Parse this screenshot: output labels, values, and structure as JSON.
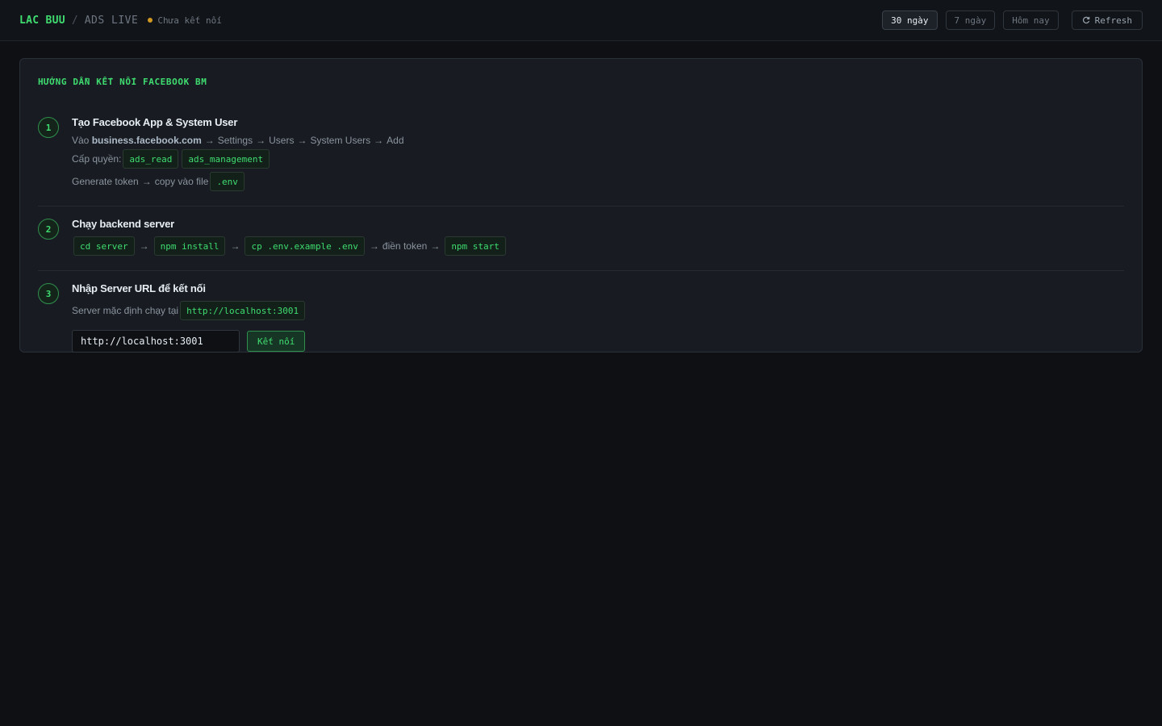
{
  "header": {
    "brand": "LAC BUU",
    "separator": "/",
    "subtitle": "ADS LIVE",
    "status": "Chưa kết nối",
    "status_color": "#d29922",
    "range_buttons": [
      {
        "label": "30 ngày",
        "active": true
      },
      {
        "label": "7 ngày",
        "active": false
      },
      {
        "label": "Hôm nay",
        "active": false
      }
    ],
    "refresh_label": "Refresh",
    "refresh_icon": "refresh-icon"
  },
  "guide": {
    "title": "HƯỚNG DẪN KẾT NỐI FACEBOOK BM",
    "accent": "#3fdc70",
    "steps": [
      {
        "number": "1",
        "title": "Tạo Facebook App & System User",
        "line1": {
          "prefix": "Vào",
          "site": "business.facebook.com",
          "path": [
            "Settings",
            "Users",
            "System Users",
            "Add"
          ]
        },
        "line2": {
          "label": "Cấp quyền:",
          "codes": [
            "ads_read",
            "ads_management"
          ]
        },
        "line3": {
          "label": "Generate token",
          "middle": "copy vào file",
          "code": ".env"
        }
      },
      {
        "number": "2",
        "title": "Chạy backend server",
        "commands": [
          "cd server",
          "npm install",
          "cp .env.example .env"
        ],
        "fill_text": "điền token",
        "final_command": "npm start"
      },
      {
        "number": "3",
        "title": "Nhập Server URL để kết nối",
        "default_text": "Server mặc định chạy tại",
        "default_url": "http://localhost:3001",
        "input_value": "http://localhost:3001",
        "connect_label": "Kết nối"
      }
    ],
    "arrow": "→"
  }
}
